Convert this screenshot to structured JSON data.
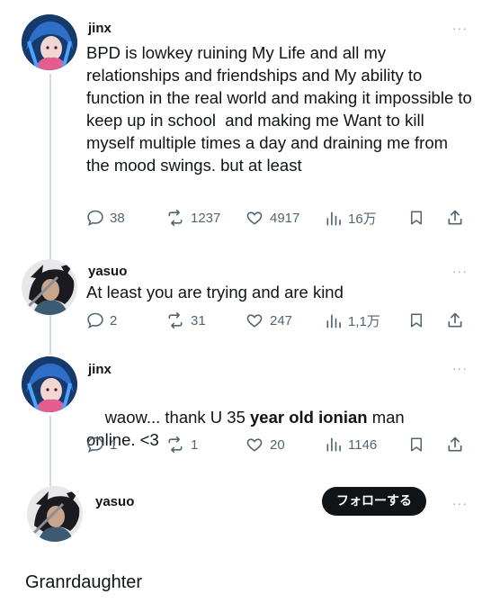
{
  "posts": [
    {
      "username": "jinx",
      "text": "BPD is lowkey ruining My Life and all my relationships and friendships and My ability to function in the real world and making it impossible to keep up in school  and making me Want to kill myself multiple times a day and draining me from the mood swings. but at least",
      "replies": "38",
      "reposts": "1237",
      "likes": "4917",
      "views": "16万"
    },
    {
      "username": "yasuo",
      "text": "At least you are trying and are kind",
      "replies": "2",
      "reposts": "31",
      "likes": "247",
      "views": "1,1万"
    },
    {
      "username": "jinx",
      "text_before": "waow... thank U 35 ",
      "text_bold": "year old ionian",
      "text_after": " man",
      "text_line2": "online. <3",
      "replies": "1",
      "reposts": "1",
      "likes": "20",
      "views": "1146"
    },
    {
      "username": "yasuo",
      "follow_label": "フォローする"
    }
  ],
  "more_glyph": "···",
  "footer": "Granrdaughter",
  "icons": {
    "reply": "reply-icon",
    "repost": "repost-icon",
    "like": "heart-icon",
    "views": "views-icon",
    "bookmark": "bookmark-icon",
    "share": "share-icon"
  },
  "colors": {
    "icon_gray": "#536471",
    "thread_line": "#cfd9de",
    "follow_bg": "#0f1419",
    "jinx_hair": "#2f6fc8",
    "yasuo_hair": "#1a1a20"
  }
}
